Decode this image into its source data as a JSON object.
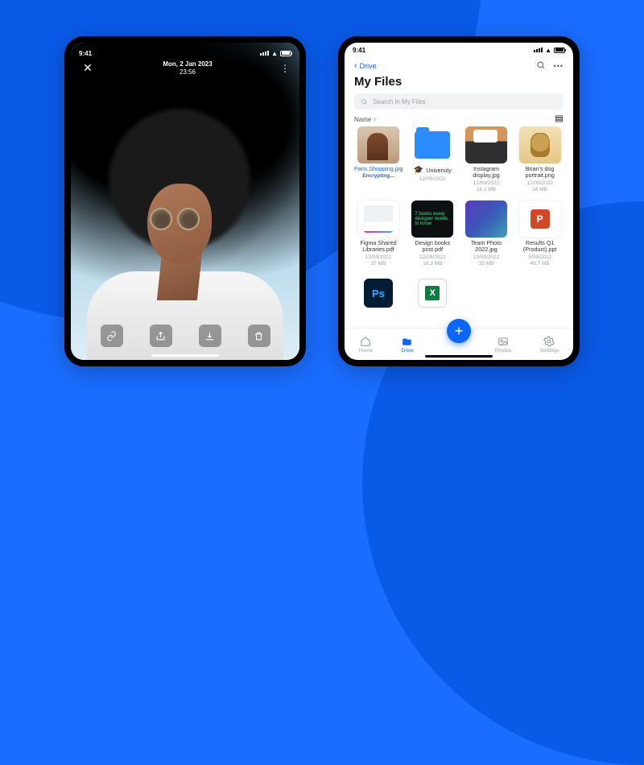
{
  "left": {
    "status_time": "9:41",
    "date_line1": "Mon, 2 Jan 2023",
    "date_line2": "23:56",
    "actions": {
      "link": "link-icon",
      "share": "share-icon",
      "download": "download-icon",
      "trash": "trash-icon"
    }
  },
  "right": {
    "status_time": "9:41",
    "back_label": "Drive",
    "title": "My Files",
    "search_placeholder": "Search in My Files",
    "sort_label": "Name",
    "files": [
      {
        "name": "Paris.Shopping.jpg",
        "status": "Encrypting...",
        "thumb": "photo1"
      },
      {
        "name": "University",
        "date": "12/09/2022",
        "thumb": "folder",
        "emoji": "🎓"
      },
      {
        "name": "Instagram display.jpg",
        "date": "12/09/2022",
        "size": "16.2 MB",
        "thumb": "ig"
      },
      {
        "name": "Brian's dog portrait.png",
        "date": "12/09/2022",
        "size": "18 MB",
        "thumb": "dog"
      },
      {
        "name": "Figma Shared Libraries.pdf",
        "date": "12/09/2022",
        "size": "37 MB",
        "thumb": "figma"
      },
      {
        "name": "Design books post.pdf",
        "date": "12/09/2022",
        "size": "16.3 MB",
        "thumb": "design",
        "thumbtext": "7 books every designer needs to know"
      },
      {
        "name": "Team Photo 2022.jpg",
        "date": "13/09/2022",
        "size": "35 MB",
        "thumb": "team"
      },
      {
        "name": "Results Q1 (Product).ppt",
        "date": "5/09/2022",
        "size": "46.7 MB",
        "thumb": "ppt"
      },
      {
        "name": "",
        "thumb": "ps"
      },
      {
        "name": "",
        "thumb": "xl"
      }
    ],
    "tabs": {
      "home": "Home",
      "drive": "Drive",
      "photos": "Photos",
      "settings": "Settings"
    }
  }
}
